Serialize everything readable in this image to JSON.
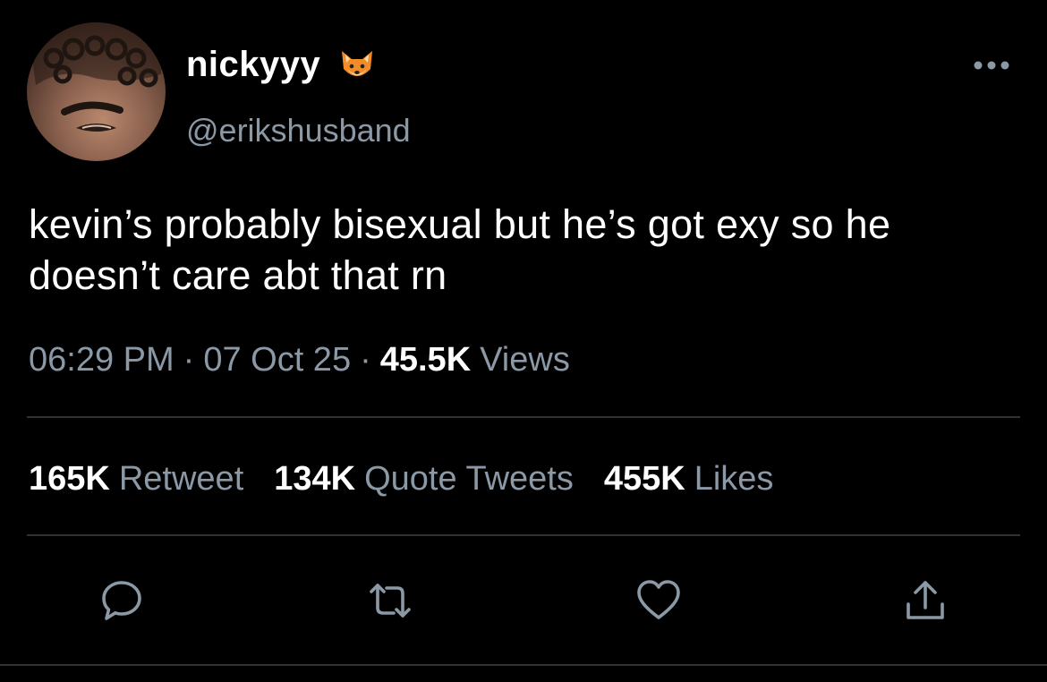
{
  "tweet": {
    "display_name": "nickyyy",
    "display_name_emoji": "fox-face",
    "handle": "@erikshusband",
    "text": "kevin’s probably bisexual but he’s got exy so he doesn’t care abt that rn",
    "time": "06:29 PM",
    "date": "07 Oct 25",
    "separator": "·",
    "views_count": "45.5K",
    "views_label": "Views"
  },
  "stats": {
    "retweets": {
      "count": "165K",
      "label": "Retweet"
    },
    "quotes": {
      "count": "134K",
      "label": "Quote Tweets"
    },
    "likes": {
      "count": "455K",
      "label": "Likes"
    }
  },
  "actions": [
    {
      "name": "reply",
      "icon": "comment-icon"
    },
    {
      "name": "retweet",
      "icon": "retweet-icon"
    },
    {
      "name": "like",
      "icon": "heart-icon"
    },
    {
      "name": "share",
      "icon": "share-icon"
    }
  ],
  "colors": {
    "background": "#000000",
    "primary_text": "#ffffff",
    "secondary_text": "#8b98a5",
    "divider": "#2f3336"
  }
}
